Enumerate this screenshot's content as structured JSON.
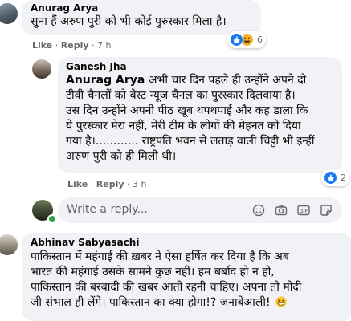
{
  "comments": [
    {
      "author": "Anurag Arya",
      "text": "सुना हैं अरुण पुरी को भी कोई पुरुस्कार मिला है।",
      "like": "Like",
      "reply": "Reply",
      "time": "7 h",
      "reaction_count": "6"
    },
    {
      "author": "Ganesh Jha",
      "tag": "Anurag Arya",
      "text_lines": [
        "अभी चार दिन पहले ही उन्होंने अपने दो",
        "टीवी चैनलों को बेस्ट न्यूज चैनल का पुरस्कार दिलवाया है।",
        "उस दिन उन्होंने अपनी पीठ खूब थपथपाई और कह डाला कि",
        "ये पुरस्कार मेरा नहीं, मेरी टीम के लोगों की मेहनत को दिया",
        "गया है।............ राष्ट्रपति भवन से लताड़ वाली चिट्ठी भी इन्हीं",
        "अरुण पुरी को ही मिली थी।"
      ],
      "like": "Like",
      "reply": "Reply",
      "time": "3 h",
      "reaction_count": "2"
    },
    {
      "author": "Abhinav Sabyasachi",
      "text_lines": [
        "पाकिस्तान में महंगाई की ख़बर ने ऐसा हर्षित कर दिया है कि अब",
        "भारत की महंगाई उसके सामने कुछ नहीं। हम बर्बाद हो न हो,",
        "पाकिस्तान की बरबादी की खबर आती रहनी चाहिए। अपना तो मोदी",
        "जी संभाल ही लेंगे। पाकिस्तान का क्या होगा!? जनाबेआली!"
      ]
    }
  ],
  "reply_box": {
    "placeholder": "Write a reply..."
  },
  "colors": {
    "like_blue": "#1877f2",
    "haha_yellow": "#f7b125",
    "bubble": "#f0f2f5",
    "meta_gray": "#65676b"
  },
  "icons": [
    "like-icon",
    "haha-icon",
    "emoji-icon",
    "camera-icon",
    "gif-icon",
    "sticker-icon",
    "grin-emoji"
  ]
}
